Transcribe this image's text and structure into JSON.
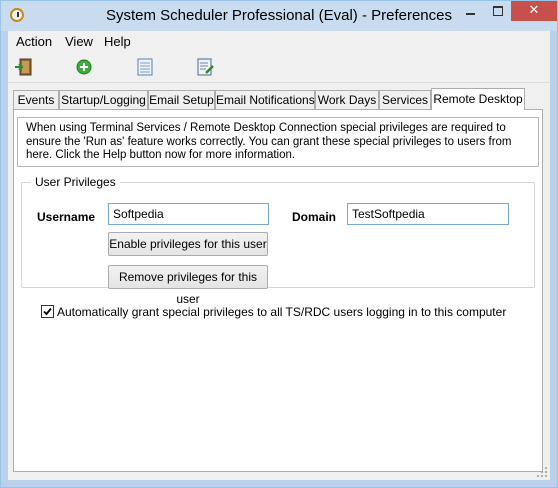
{
  "window": {
    "title": "System Scheduler Professional (Eval) - Preferences",
    "close_glyph": "✕"
  },
  "menu": {
    "items": [
      {
        "label": "Action"
      },
      {
        "label": "View"
      },
      {
        "label": "Help"
      }
    ]
  },
  "toolbar": {
    "buttons": [
      {
        "icon": "exit-door-icon"
      },
      {
        "icon": "add-icon"
      },
      {
        "icon": "list-view-icon"
      },
      {
        "icon": "notes-icon"
      }
    ]
  },
  "tabs": [
    {
      "label": "Events"
    },
    {
      "label": "Startup/Logging"
    },
    {
      "label": "Email Setup"
    },
    {
      "label": "Email Notifications"
    },
    {
      "label": "Work Days"
    },
    {
      "label": "Services"
    },
    {
      "label": "Remote Desktop",
      "active": true
    }
  ],
  "remote_desktop": {
    "info_text": "When using Terminal Services / Remote Desktop Connection special privileges are required to ensure the 'Run as' feature works correctly. You can grant these special privileges to users from here. Click the Help button now for more information.",
    "group_title": "User Privileges",
    "username_label": "Username",
    "username_value": "Softpedia",
    "domain_label": "Domain",
    "domain_value": "TestSoftpedia",
    "enable_button": "Enable privileges for this user",
    "remove_button": "Remove privileges for this user",
    "auto_grant_label": "Automatically grant special privileges to all TS/RDC users logging in to this computer",
    "auto_grant_checked": true
  },
  "colors": {
    "titlebar": "#c9dcef",
    "close_button": "#c7504b",
    "input_border": "#7aa7d6"
  }
}
